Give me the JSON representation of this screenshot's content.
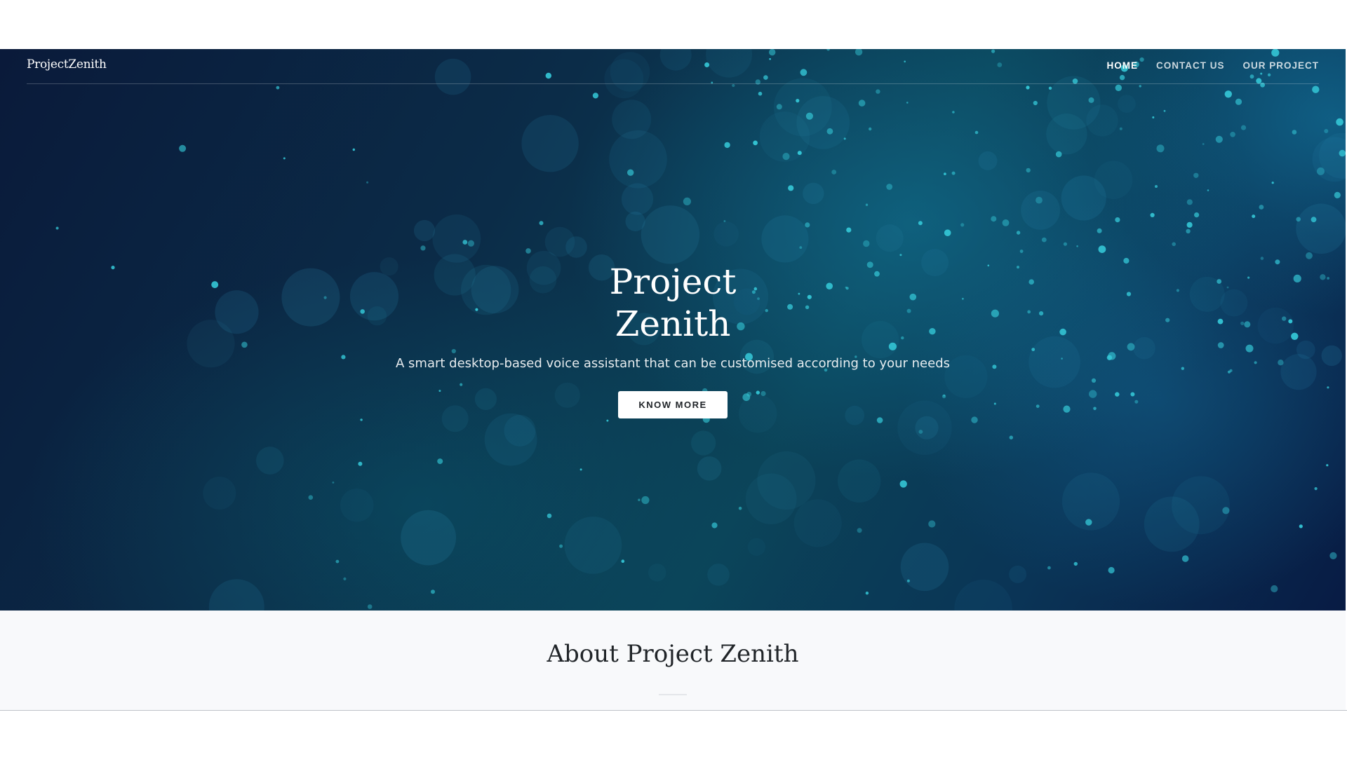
{
  "navbar": {
    "brand": "ProjectZenith",
    "links": [
      {
        "label": "HOME",
        "active": true
      },
      {
        "label": "CONTACT US",
        "active": false
      },
      {
        "label": "OUR PROJECT",
        "active": false
      }
    ]
  },
  "hero": {
    "title_line1": "Project",
    "title_line2": "Zenith",
    "subtitle": "A smart desktop-based voice assistant that can be customised according to your needs",
    "button_label": "KNOW MORE"
  },
  "about": {
    "title": "About Project Zenith"
  },
  "colors": {
    "hero_dark": "#0a1a3a",
    "hero_teal": "#0b4358",
    "particle": "#35c9d8",
    "about_bg": "#f8f9fb",
    "text_dark": "#212529"
  }
}
